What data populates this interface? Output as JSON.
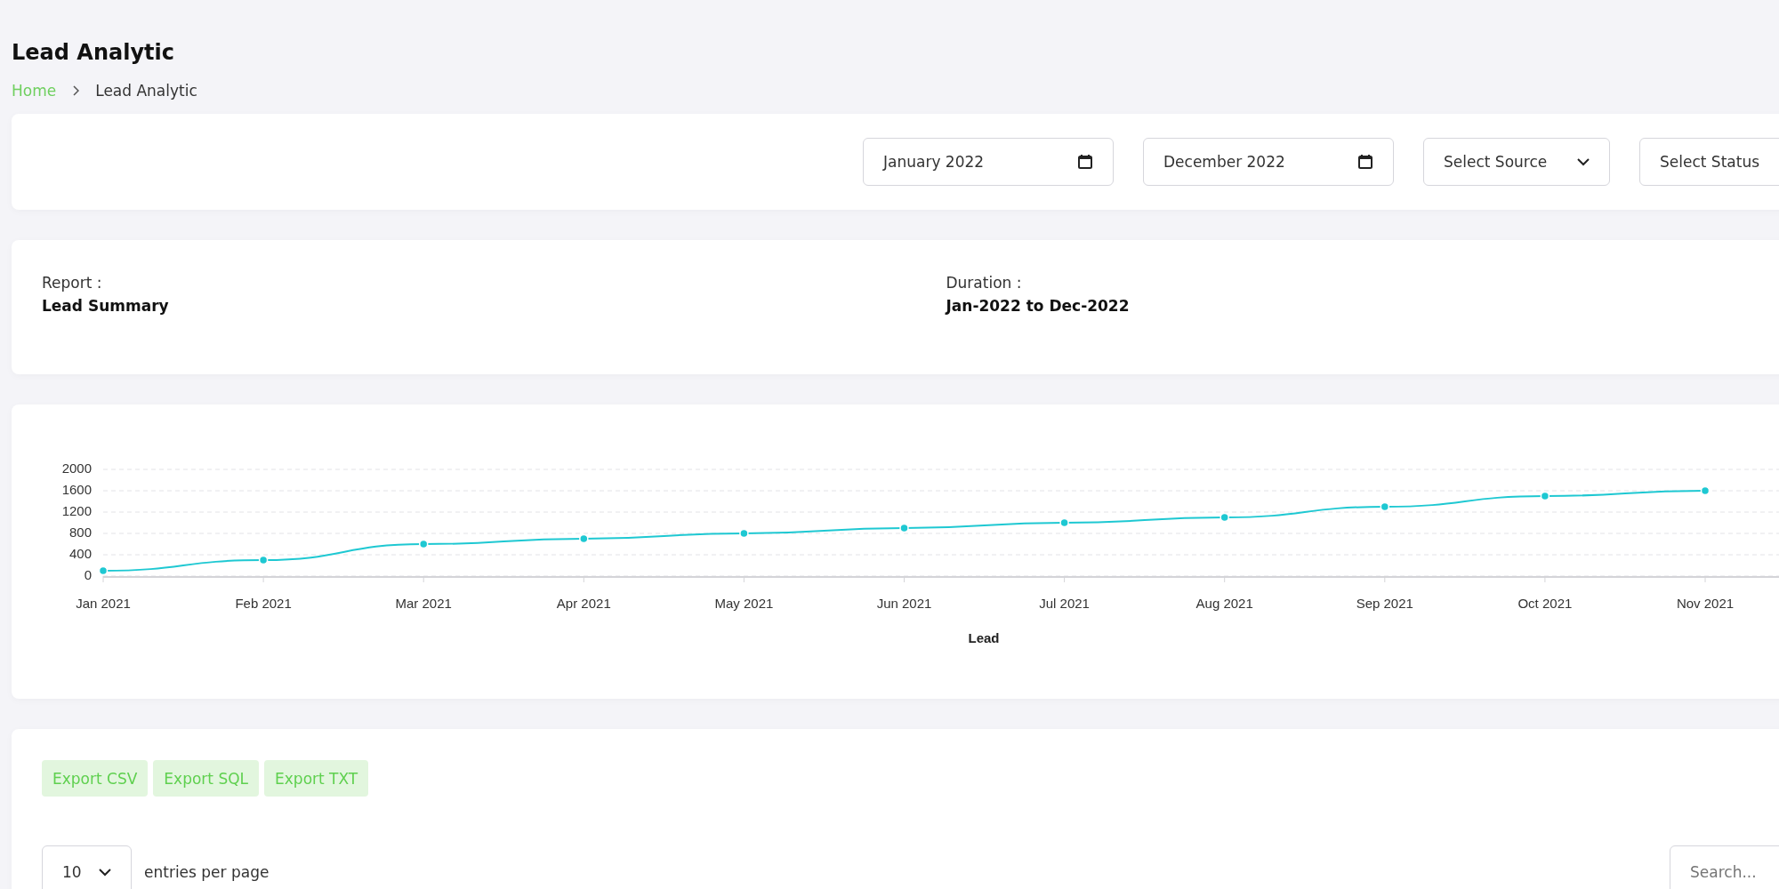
{
  "page_title": "Lead Analytic",
  "breadcrumb": [
    {
      "label": "Home",
      "kind": "link"
    },
    {
      "label": "Lead Analytic",
      "kind": "current"
    }
  ],
  "filters": {
    "start_date": "January 2022",
    "end_date": "December 2022",
    "source": "Select Source",
    "status": "Select Status"
  },
  "report": {
    "label": "Report :",
    "value": "Lead Summary"
  },
  "duration": {
    "label": "Duration :",
    "value": "Jan-2022 to Dec-2022"
  },
  "chart": {
    "chart_data": {
      "type": "line",
      "grid": true,
      "categories": [
        "Jan 2021",
        "Feb 2021",
        "Mar 2021",
        "Apr 2021",
        "May 2021",
        "Jun 2021",
        "Jul 2021",
        "Aug 2021",
        "Sep 2021",
        "Oct 2021",
        "Nov 2021"
      ],
      "series": [
        {
          "name": "Lead",
          "color": "#1ec8d2",
          "marker": true,
          "values": [
            100,
            300,
            600,
            700,
            800,
            900,
            1000,
            1100,
            1300,
            1500,
            1600
          ]
        }
      ],
      "ylim": [
        0,
        2000
      ],
      "yticks": [
        0,
        400,
        800,
        1200,
        1600,
        2000
      ]
    }
  },
  "export_buttons": [
    "Export CSV",
    "Export SQL",
    "Export TXT"
  ],
  "entries": {
    "value": "10",
    "label": "entries per page"
  },
  "search": {
    "placeholder": "Search..."
  }
}
